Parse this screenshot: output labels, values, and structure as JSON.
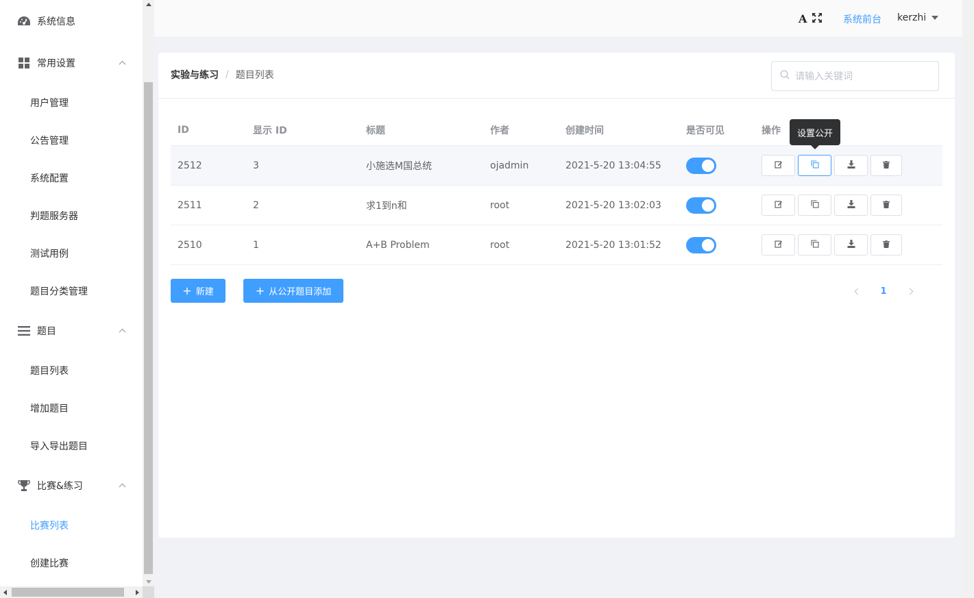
{
  "sidebar": {
    "sysinfo": "系统信息",
    "common": {
      "label": "常用设置",
      "items": [
        "用户管理",
        "公告管理",
        "系统配置",
        "判题服务器",
        "测试用例",
        "题目分类管理"
      ]
    },
    "problem": {
      "label": "题目",
      "items": [
        "题目列表",
        "增加题目",
        "导入导出题目"
      ]
    },
    "contest": {
      "label": "比赛&练习",
      "items": [
        "比赛列表",
        "创建比赛"
      ]
    },
    "active_item": "比赛列表"
  },
  "header": {
    "front_link": "系统前台",
    "username": "kerzhi",
    "icons": [
      "font-size-icon",
      "fullscreen-icon"
    ]
  },
  "breadcrumb": {
    "parent": "实验与练习",
    "separator": "/",
    "current": "题目列表"
  },
  "search": {
    "placeholder": "请输入关键词"
  },
  "table": {
    "headers": {
      "id": "ID",
      "display_id": "显示 ID",
      "title": "标题",
      "author": "作者",
      "created": "创建时间",
      "visible": "是否可见",
      "ops": "操作"
    },
    "rows": [
      {
        "id": "2512",
        "display_id": "3",
        "title": "小施选M国总统",
        "author": "ojadmin",
        "created": "2021-5-20 13:04:55",
        "visible": true
      },
      {
        "id": "2511",
        "display_id": "2",
        "title": "求1到n和",
        "author": "root",
        "created": "2021-5-20 13:02:03",
        "visible": true
      },
      {
        "id": "2510",
        "display_id": "1",
        "title": "A+B Problem",
        "author": "root",
        "created": "2021-5-20 13:01:52",
        "visible": true
      }
    ]
  },
  "tooltip": "设置公开",
  "buttons": {
    "new": "新建",
    "add_public": "从公开题目添加"
  },
  "pagination": {
    "current": "1"
  },
  "colors": {
    "primary": "#409eff",
    "tooltip_bg": "#303133"
  }
}
